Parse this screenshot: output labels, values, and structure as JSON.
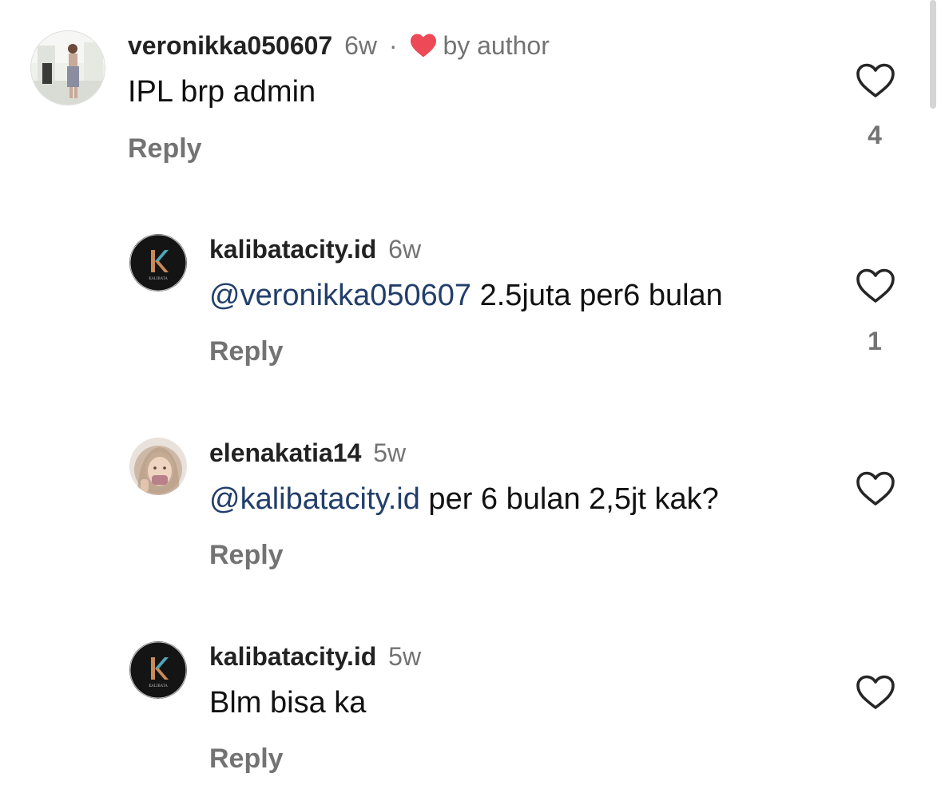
{
  "comments": [
    {
      "username": "veronikka050607",
      "time": "6w",
      "separator": "·",
      "by_author_label": "by author",
      "text": "IPL brp admin",
      "reply_label": "Reply",
      "like_count": "4"
    },
    {
      "username": "kalibatacity.id",
      "time": "6w",
      "mention": "@veronikka050607",
      "text": " 2.5juta per6 bulan",
      "reply_label": "Reply",
      "like_count": "1"
    },
    {
      "username": "elenakatia14",
      "time": "5w",
      "mention": "@kalibatacity.id",
      "text": " per 6 bulan 2,5jt kak?",
      "reply_label": "Reply"
    },
    {
      "username": "kalibatacity.id",
      "time": "5w",
      "text": "Blm bisa ka",
      "reply_label": "Reply"
    }
  ],
  "logo": {
    "letter": "K",
    "caption": "KALIBATA"
  },
  "colors": {
    "mention": "#223e6b",
    "heart_red": "#ed4956",
    "meta_gray": "#737373"
  },
  "icons": {
    "like": "heart-outline-icon",
    "by_author": "heart-filled-icon"
  }
}
